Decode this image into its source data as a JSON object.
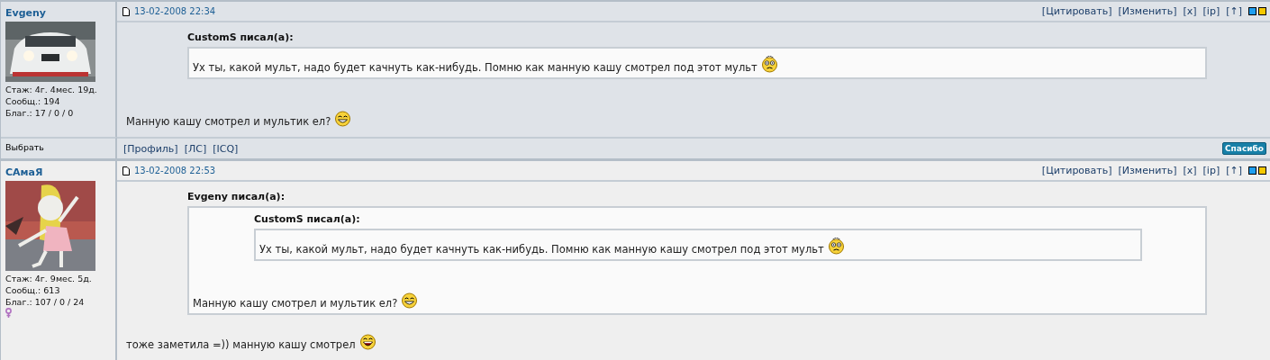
{
  "posts": [
    {
      "kind": "dark",
      "author": "Evgeny",
      "stats": [
        "Стаж: 4г. 4мес. 19д.",
        "Сообщ.: 194",
        "Благ.: 17 / 0 / 0"
      ],
      "date": "13-02-2008 22:34",
      "actions": [
        "[Цитировать]",
        "[Изменить]",
        "[x]",
        "[ip]",
        "[↑]"
      ],
      "body": {
        "quote": {
          "author": "CustomS писал(а):",
          "body": {
            "text": "Ух ты, какой мульт, надо будет качнуть как-нибудь. Помню как манную кашу смотрел под этот мульт",
            "smiley": {
              "kind": "dizzy"
            }
          }
        },
        "text": "Манную кашу смотрел и мультик ел?",
        "smiley": {
          "kind": "grin"
        }
      },
      "footer": {
        "select": "Выбрать",
        "links": [
          "[Профиль]",
          "[ЛС]",
          "[ICQ]"
        ],
        "thanks": "Спасибо"
      }
    },
    {
      "kind": "light",
      "author": "САмаЯ",
      "stats": [
        "Стаж: 4г. 9мес. 5д.",
        "Сообщ.: 613",
        "Благ.: 107 / 0 / 24"
      ],
      "gender_icon": {
        "kind": "female"
      },
      "date": "13-02-2008 22:53",
      "actions": [
        "[Цитировать]",
        "[Изменить]",
        "[x]",
        "[ip]",
        "[↑]"
      ],
      "body": {
        "quote": {
          "author": "Evgeny писал(а):",
          "body": {
            "quote": {
              "author": "CustomS писал(а):",
              "body": {
                "text": "Ух ты, какой мульт, надо будет качнуть как-нибудь. Помню как манную кашу смотрел под этот мульт",
                "smiley": {
                  "kind": "dizzy"
                }
              }
            },
            "text": "Манную кашу смотрел и мультик ел?",
            "smiley": {
              "kind": "grin"
            }
          }
        },
        "text": "тоже заметила =)) манную кашу смотрел",
        "smiley": {
          "kind": "laugh"
        }
      }
    }
  ]
}
